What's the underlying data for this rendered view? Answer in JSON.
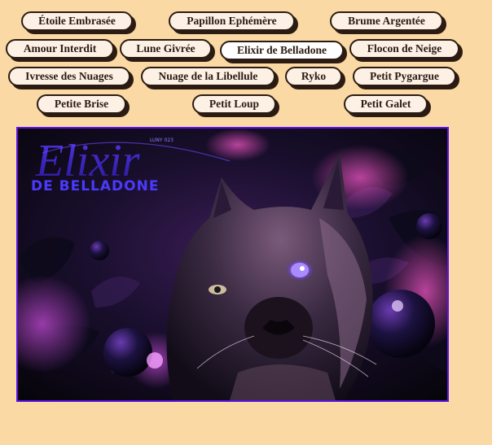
{
  "nav": {
    "row1": [
      "Étoile Embrasée",
      "Papillon Ephémère",
      "Brume Argentée"
    ],
    "row2": [
      "Amour Interdit",
      "Lune Givrée",
      "Elixir de Belladone",
      "Flocon de Neige"
    ],
    "row3": [
      "Ivresse des Nuages",
      "Nuage de la Libellule",
      "Ryko",
      "Petit Pygargue"
    ],
    "row4": [
      "Petite Brise",
      "Petit Loup",
      "Petit Galet"
    ],
    "active": "Elixir de Belladone"
  },
  "artwork": {
    "title_script": "Elixir",
    "title_sub": "DE BELLADONE",
    "credit": "LUNY 023"
  },
  "colors": {
    "page_background": "#fad9a4",
    "pill_background": "#fdf1e6",
    "pill_shadow": "#2b1b12",
    "frame_border": "#5a14e8"
  }
}
